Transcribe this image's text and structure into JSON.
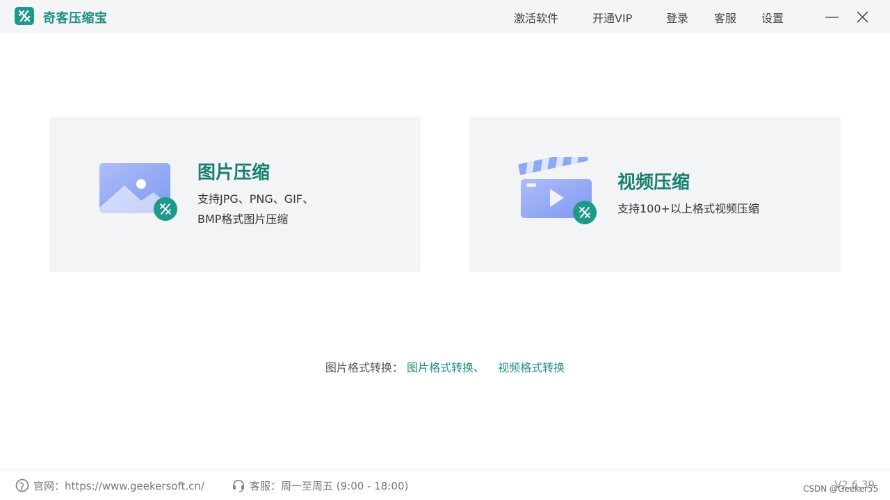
{
  "app": {
    "title": "奇客压缩宝"
  },
  "topnav": {
    "activate": "激活软件",
    "vip": "开通VIP",
    "login": "登录",
    "service": "客服",
    "settings": "设置"
  },
  "cards": {
    "image": {
      "title": "图片压缩",
      "desc_line1": "支持JPG、PNG、GIF、",
      "desc_line2": "BMP格式图片压缩"
    },
    "video": {
      "title": "视频压缩",
      "desc": "支持100+以上格式视频压缩"
    }
  },
  "formats": {
    "label": "图片格式转换：",
    "image_link": "图片格式转换",
    "separator": "、",
    "video_link": "视频格式转换"
  },
  "footer": {
    "website": "官网：https://www.geekersoft.cn/",
    "service": "客服：周一至周五 (9:00 - 18:00)",
    "version": "V2.6.39",
    "watermark": "CSDN @Geeker55"
  },
  "colors": {
    "accent": "#1f9a8a",
    "titlebar_bg": "#f4f5f7",
    "card_bg": "#f3f4f6",
    "icon_blue": "#8fa8f5"
  }
}
